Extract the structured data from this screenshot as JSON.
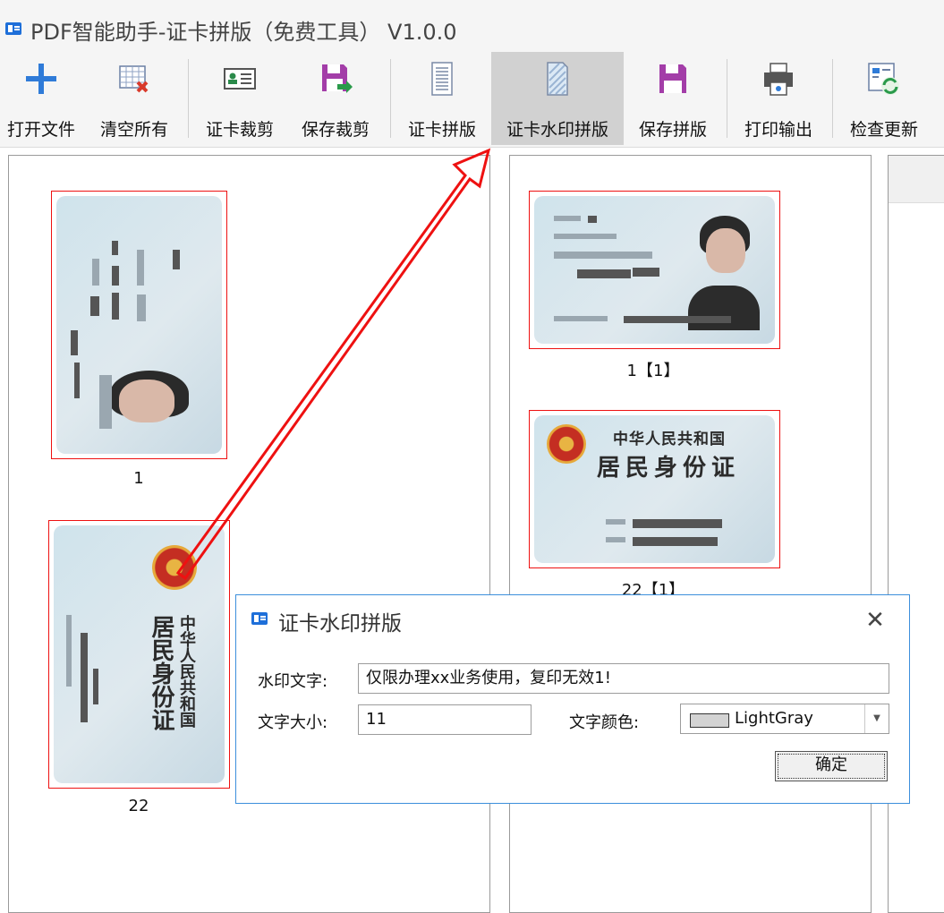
{
  "window": {
    "title": "PDF智能助手-证卡拼版（免费工具） V1.0.0"
  },
  "toolbar": {
    "open_file": "打开文件",
    "clear_all": "清空所有",
    "card_crop": "证卡裁剪",
    "save_crop": "保存裁剪",
    "card_layout": "证卡拼版",
    "watermark_layout": "证卡水印拼版",
    "save_layout": "保存拼版",
    "print_output": "打印输出",
    "check_update": "检查更新"
  },
  "left_panel": {
    "captions": [
      "1",
      "22"
    ]
  },
  "middle_panel": {
    "captions": [
      "1【1】",
      "22【1】"
    ],
    "card_title_line1": "中华人民共和国",
    "card_title_line2": "居民身份证"
  },
  "dialog": {
    "title": "证卡水印拼版",
    "watermark_label": "水印文字:",
    "watermark_value": "仅限办理xx业务使用，复印无效1!",
    "size_label": "文字大小:",
    "size_value": "11",
    "color_label": "文字颜色:",
    "color_value": "LightGray",
    "ok_label": "确定"
  },
  "colors": {
    "accent": "#3c8fdc",
    "highlight_red": "#e11111",
    "swatch": "#d3d3d3"
  }
}
